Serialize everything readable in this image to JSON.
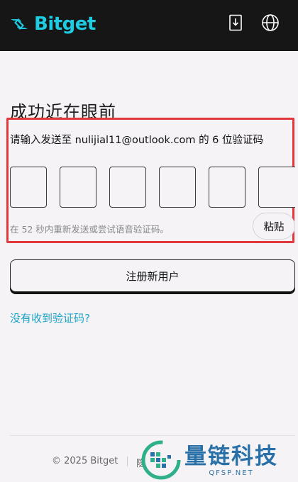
{
  "header": {
    "brand": "Bitget",
    "icons": [
      "download-icon",
      "globe-icon"
    ]
  },
  "verify": {
    "title": "成功近在眼前",
    "instruction": "请输入发送至 nulijial11@outlook.com 的 6 位验证码",
    "code_digits": [
      "",
      "",
      "",
      "",
      "",
      ""
    ],
    "resend_text": "在 52 秒内重新发送或尝试语音验证码。",
    "paste_label": "粘贴"
  },
  "actions": {
    "register_label": "注册新用户",
    "no_code_link": "没有收到验证码?"
  },
  "footer": {
    "copyright": "© 2025 Bitget",
    "link_partial": "隐"
  },
  "watermark": {
    "title": "量链科技",
    "subtitle": "QFSP.NET"
  },
  "colors": {
    "brand": "#1ecbe1",
    "highlight_border": "#e0383b",
    "link": "#1aa3c9",
    "watermark": "#2a70a8"
  }
}
